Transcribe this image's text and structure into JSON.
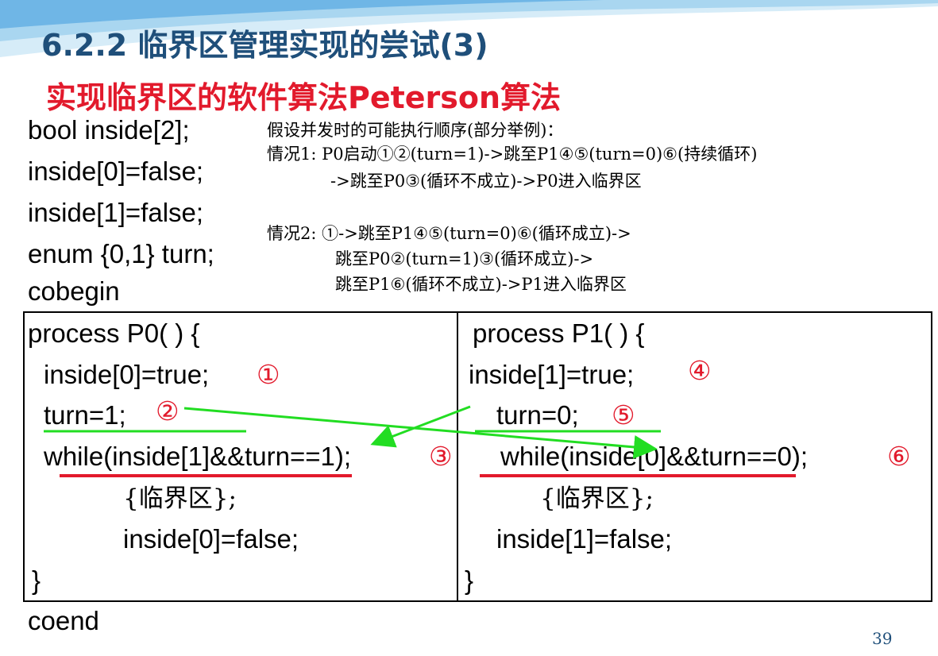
{
  "title": "6.2.2 临界区管理实现的尝试(3)",
  "subtitle": "实现临界区的软件算法Peterson算法",
  "declarations": [
    "bool inside[2];",
    "inside[0]=false;",
    "inside[1]=false;",
    "enum {0,1} turn;",
    "cobegin"
  ],
  "notes": {
    "intro": "假设并发时的可能执行顺序(部分举例)：",
    "case1_line1": "情况1: P0启动①②(turn=1)->跳至P1④⑤(turn=0)⑥(持续循环)",
    "case1_line2": "->跳至P0③(循环不成立)->P0进入临界区",
    "case2_line1": "情况2: ①->跳至P1④⑤(turn=0)⑥(循环成立)->",
    "case2_line2": "跳至P0②(turn=1)③(循环成立)->",
    "case2_line3": "跳至P1⑥(循环不成立)->P1进入临界区"
  },
  "p0": {
    "header": "process P0( ) {",
    "l1": "inside[0]=true;",
    "l1_mark": "①",
    "l2": "turn=1;",
    "l2_mark": "②",
    "l3": "while(inside[1]&&turn==1);",
    "l3_mark": "③",
    "l4": "{临界区};",
    "l5": "inside[0]=false;",
    "close": "}"
  },
  "p1": {
    "header": "process P1( ) {",
    "l1": "inside[1]=true;",
    "l1_mark": "④",
    "l2": "turn=0;",
    "l2_mark": "⑤",
    "l3": "while(inside[0]&&turn==0);",
    "l3_mark": "⑥",
    "l4": "{临界区};",
    "l5": "inside[1]=false;",
    "close": "}"
  },
  "coend": "coend",
  "page_number": "39",
  "colors": {
    "title": "#1f4f7a",
    "subtitle": "#e21a2c",
    "circled_marks": "#e21a2c",
    "green_lines": "#22dd22",
    "red_underlines": "#e21a2c"
  }
}
